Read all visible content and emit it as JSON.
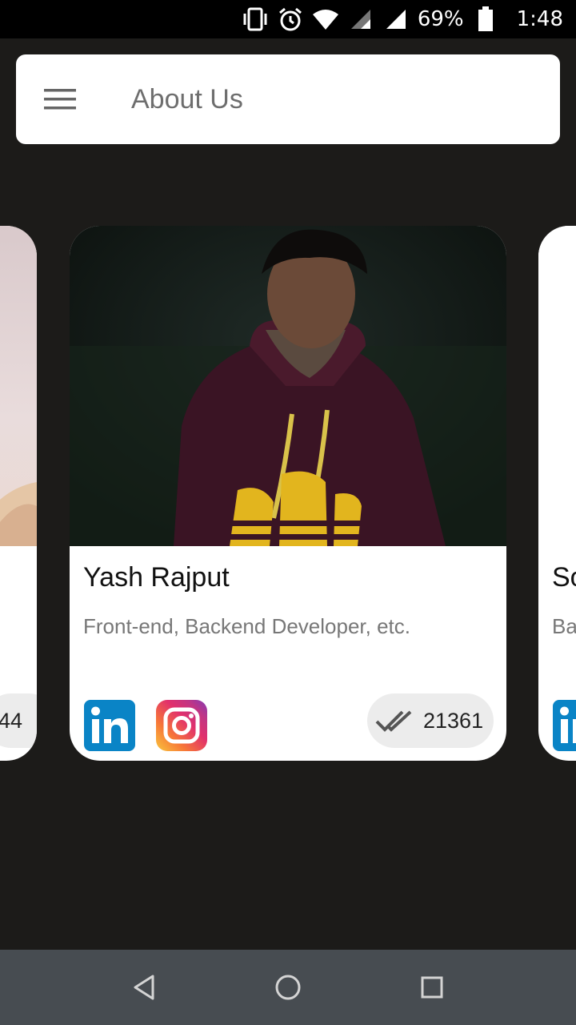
{
  "status_bar": {
    "battery_percent": "69%",
    "time": "1:48",
    "icons": [
      "vibrate-icon",
      "alarm-icon",
      "wifi-icon",
      "signal-icon",
      "signal-icon",
      "battery-icon"
    ]
  },
  "app_bar": {
    "title": "About Us",
    "menu_icon": "hamburger-menu-icon"
  },
  "cards": [
    {
      "position": "left-partial",
      "name": "",
      "role": "",
      "count": "44"
    },
    {
      "position": "center",
      "name": "Yash Rajput",
      "role": "Front-end, Backend Developer, etc.",
      "count": "21361",
      "socials": [
        "linkedin",
        "instagram"
      ]
    },
    {
      "position": "right-partial",
      "name": "So",
      "role": "Ba",
      "socials": [
        "linkedin"
      ]
    }
  ],
  "nav_bar": {
    "back_icon": "back-triangle-icon",
    "home_icon": "home-circle-icon",
    "recents_icon": "recents-square-icon"
  }
}
